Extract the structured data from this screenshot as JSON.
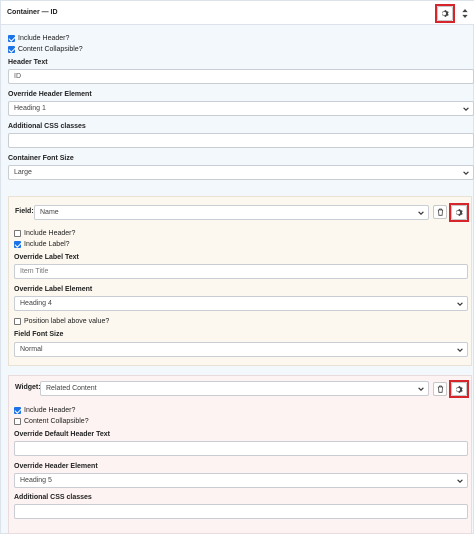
{
  "container": {
    "title": "Container — ID",
    "include_header": "Include Header?",
    "content_collapsible": "Content Collapsible?",
    "header_text_label": "Header Text",
    "header_text_value": "ID",
    "override_header_label": "Override Header Element",
    "override_header_value": "Heading 1",
    "css_classes_label": "Additional CSS classes",
    "css_classes_value": "",
    "font_size_label": "Container Font Size",
    "font_size_value": "Large"
  },
  "field": {
    "label": "Field:",
    "select_value": "Name",
    "include_header": "Include Header?",
    "include_label": "Include Label?",
    "override_label_text_label": "Override Label Text",
    "override_label_text_placeholder": "Item Title",
    "override_label_element_label": "Override Label Element",
    "override_label_element_value": "Heading 4",
    "position_label": "Position label above value?",
    "font_size_label": "Field Font Size",
    "font_size_value": "Normal"
  },
  "widget": {
    "label": "Widget:",
    "select_value": "Related Content",
    "include_header": "Include Header?",
    "content_collapsible": "Content Collapsible?",
    "override_default_header_label": "Override Default Header Text",
    "override_default_header_value": "",
    "override_header_label": "Override Header Element",
    "override_header_value": "Heading 5",
    "css_classes_label": "Additional CSS classes",
    "css_classes_value": ""
  },
  "colors": {
    "highlight": "#d6262b",
    "checkbox": "#1a73e8",
    "container_bg": "#f3f8fd",
    "field_bg": "#fdf8ef",
    "widget_bg": "#fdf3f2"
  },
  "icons": {
    "gear": "gear-icon",
    "sort": "sort-arrows-icon",
    "trash": "trash-icon",
    "chevron": "chevron-down-icon"
  }
}
